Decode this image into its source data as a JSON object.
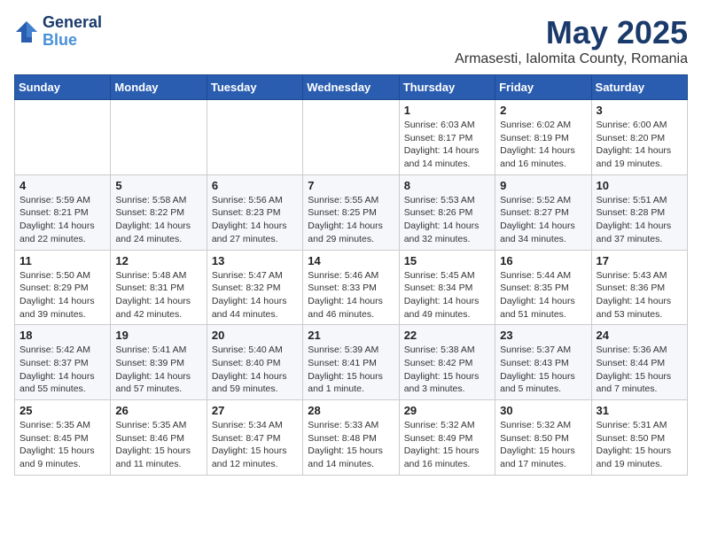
{
  "header": {
    "logo_line1": "General",
    "logo_line2": "Blue",
    "month": "May 2025",
    "location": "Armasesti, Ialomita County, Romania"
  },
  "weekdays": [
    "Sunday",
    "Monday",
    "Tuesday",
    "Wednesday",
    "Thursday",
    "Friday",
    "Saturday"
  ],
  "weeks": [
    [
      {
        "day": "",
        "info": ""
      },
      {
        "day": "",
        "info": ""
      },
      {
        "day": "",
        "info": ""
      },
      {
        "day": "",
        "info": ""
      },
      {
        "day": "1",
        "info": "Sunrise: 6:03 AM\nSunset: 8:17 PM\nDaylight: 14 hours\nand 14 minutes."
      },
      {
        "day": "2",
        "info": "Sunrise: 6:02 AM\nSunset: 8:19 PM\nDaylight: 14 hours\nand 16 minutes."
      },
      {
        "day": "3",
        "info": "Sunrise: 6:00 AM\nSunset: 8:20 PM\nDaylight: 14 hours\nand 19 minutes."
      }
    ],
    [
      {
        "day": "4",
        "info": "Sunrise: 5:59 AM\nSunset: 8:21 PM\nDaylight: 14 hours\nand 22 minutes."
      },
      {
        "day": "5",
        "info": "Sunrise: 5:58 AM\nSunset: 8:22 PM\nDaylight: 14 hours\nand 24 minutes."
      },
      {
        "day": "6",
        "info": "Sunrise: 5:56 AM\nSunset: 8:23 PM\nDaylight: 14 hours\nand 27 minutes."
      },
      {
        "day": "7",
        "info": "Sunrise: 5:55 AM\nSunset: 8:25 PM\nDaylight: 14 hours\nand 29 minutes."
      },
      {
        "day": "8",
        "info": "Sunrise: 5:53 AM\nSunset: 8:26 PM\nDaylight: 14 hours\nand 32 minutes."
      },
      {
        "day": "9",
        "info": "Sunrise: 5:52 AM\nSunset: 8:27 PM\nDaylight: 14 hours\nand 34 minutes."
      },
      {
        "day": "10",
        "info": "Sunrise: 5:51 AM\nSunset: 8:28 PM\nDaylight: 14 hours\nand 37 minutes."
      }
    ],
    [
      {
        "day": "11",
        "info": "Sunrise: 5:50 AM\nSunset: 8:29 PM\nDaylight: 14 hours\nand 39 minutes."
      },
      {
        "day": "12",
        "info": "Sunrise: 5:48 AM\nSunset: 8:31 PM\nDaylight: 14 hours\nand 42 minutes."
      },
      {
        "day": "13",
        "info": "Sunrise: 5:47 AM\nSunset: 8:32 PM\nDaylight: 14 hours\nand 44 minutes."
      },
      {
        "day": "14",
        "info": "Sunrise: 5:46 AM\nSunset: 8:33 PM\nDaylight: 14 hours\nand 46 minutes."
      },
      {
        "day": "15",
        "info": "Sunrise: 5:45 AM\nSunset: 8:34 PM\nDaylight: 14 hours\nand 49 minutes."
      },
      {
        "day": "16",
        "info": "Sunrise: 5:44 AM\nSunset: 8:35 PM\nDaylight: 14 hours\nand 51 minutes."
      },
      {
        "day": "17",
        "info": "Sunrise: 5:43 AM\nSunset: 8:36 PM\nDaylight: 14 hours\nand 53 minutes."
      }
    ],
    [
      {
        "day": "18",
        "info": "Sunrise: 5:42 AM\nSunset: 8:37 PM\nDaylight: 14 hours\nand 55 minutes."
      },
      {
        "day": "19",
        "info": "Sunrise: 5:41 AM\nSunset: 8:39 PM\nDaylight: 14 hours\nand 57 minutes."
      },
      {
        "day": "20",
        "info": "Sunrise: 5:40 AM\nSunset: 8:40 PM\nDaylight: 14 hours\nand 59 minutes."
      },
      {
        "day": "21",
        "info": "Sunrise: 5:39 AM\nSunset: 8:41 PM\nDaylight: 15 hours\nand 1 minute."
      },
      {
        "day": "22",
        "info": "Sunrise: 5:38 AM\nSunset: 8:42 PM\nDaylight: 15 hours\nand 3 minutes."
      },
      {
        "day": "23",
        "info": "Sunrise: 5:37 AM\nSunset: 8:43 PM\nDaylight: 15 hours\nand 5 minutes."
      },
      {
        "day": "24",
        "info": "Sunrise: 5:36 AM\nSunset: 8:44 PM\nDaylight: 15 hours\nand 7 minutes."
      }
    ],
    [
      {
        "day": "25",
        "info": "Sunrise: 5:35 AM\nSunset: 8:45 PM\nDaylight: 15 hours\nand 9 minutes."
      },
      {
        "day": "26",
        "info": "Sunrise: 5:35 AM\nSunset: 8:46 PM\nDaylight: 15 hours\nand 11 minutes."
      },
      {
        "day": "27",
        "info": "Sunrise: 5:34 AM\nSunset: 8:47 PM\nDaylight: 15 hours\nand 12 minutes."
      },
      {
        "day": "28",
        "info": "Sunrise: 5:33 AM\nSunset: 8:48 PM\nDaylight: 15 hours\nand 14 minutes."
      },
      {
        "day": "29",
        "info": "Sunrise: 5:32 AM\nSunset: 8:49 PM\nDaylight: 15 hours\nand 16 minutes."
      },
      {
        "day": "30",
        "info": "Sunrise: 5:32 AM\nSunset: 8:50 PM\nDaylight: 15 hours\nand 17 minutes."
      },
      {
        "day": "31",
        "info": "Sunrise: 5:31 AM\nSunset: 8:50 PM\nDaylight: 15 hours\nand 19 minutes."
      }
    ]
  ]
}
